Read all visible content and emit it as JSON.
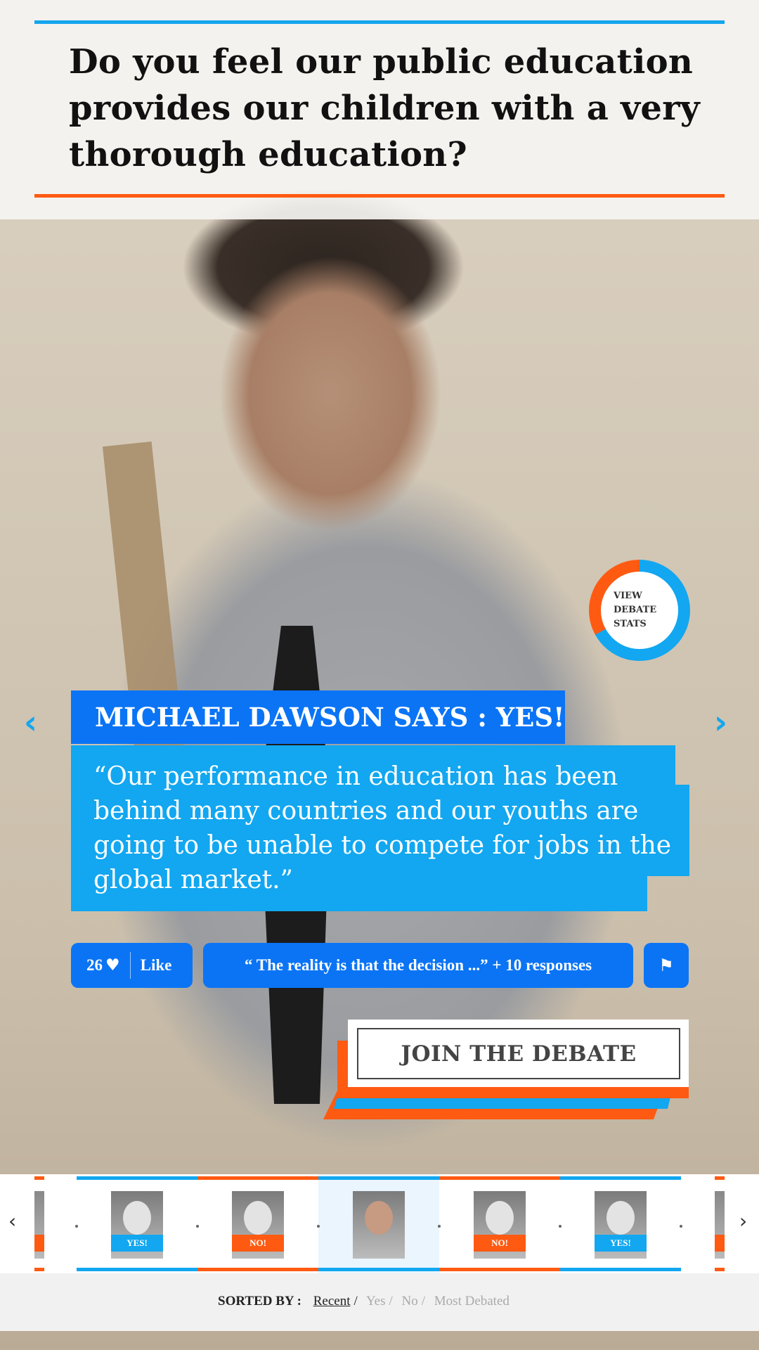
{
  "question": "Do you feel our public education provides our children with a very thorough education?",
  "stats_button": "VIEW\nDEBATE\nSTATS",
  "nav": {
    "prev_icon": "chevron-left-icon",
    "next_icon": "chevron-right-icon"
  },
  "speaker": "MICHAEL DAWSON SAYS : YES!",
  "quote": "“Our performance in education has been behind many countries and our youths are going to be unable to compete for jobs in the global market.”",
  "actions": {
    "like_count": "26",
    "like_label": "Like",
    "responses": "“ The reality is that the decision ...” + 10 responses",
    "flag_icon": "flag-icon"
  },
  "join_label": "JOIN THE DEBATE",
  "thumbnails": [
    {
      "badge": "YES!",
      "color": "#12a7f0"
    },
    {
      "badge": "NO!",
      "color": "#ff5a12"
    },
    {
      "badge": "",
      "color": "#12a7f0",
      "active": true
    },
    {
      "badge": "NO!",
      "color": "#ff5a12"
    },
    {
      "badge": "YES!",
      "color": "#12a7f0"
    }
  ],
  "sort": {
    "label": "SORTED BY :",
    "options": [
      "Recent",
      "Yes",
      "No",
      "Most Debated"
    ],
    "active": "Recent"
  },
  "colors": {
    "blue": "#0a74f5",
    "light_blue": "#12a7f0",
    "orange": "#ff5a12"
  }
}
